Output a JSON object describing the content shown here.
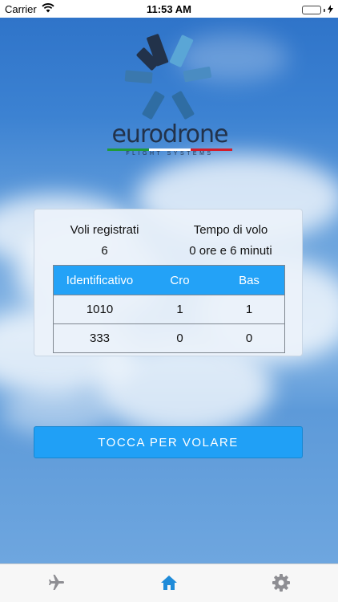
{
  "status_bar": {
    "carrier": "Carrier",
    "time": "11:53 AM",
    "wifi_icon": "wifi-icon",
    "battery_icon": "battery-icon",
    "battery_level": 1.0,
    "charging_icon": "bolt-icon"
  },
  "logo": {
    "brand": "eurodrone",
    "tagline": "FLIGHT SYSTEMS",
    "colors": {
      "dark": "#22324a",
      "light": "#5aa6d6",
      "mid": "#2f6da3"
    }
  },
  "stats": {
    "flights_label": "Voli registrati",
    "flights_value": "6",
    "time_label": "Tempo di volo",
    "time_value": "0 ore e 6 minuti"
  },
  "table": {
    "columns": [
      "Identificativo",
      "Cro",
      "Bas"
    ],
    "rows": [
      [
        "1010",
        "1",
        "1"
      ],
      [
        "333",
        "0",
        "0"
      ]
    ],
    "header_color": "#23a2f7"
  },
  "fly_button": {
    "label": "TOCCA PER VOLARE",
    "color": "#20a0f6"
  },
  "tab_bar": {
    "items": [
      {
        "icon": "airplane-icon",
        "active": false
      },
      {
        "icon": "home-icon",
        "active": true
      },
      {
        "icon": "gear-icon",
        "active": false
      }
    ],
    "active_color": "#1f8bd9",
    "inactive_color": "#8e8e93"
  }
}
